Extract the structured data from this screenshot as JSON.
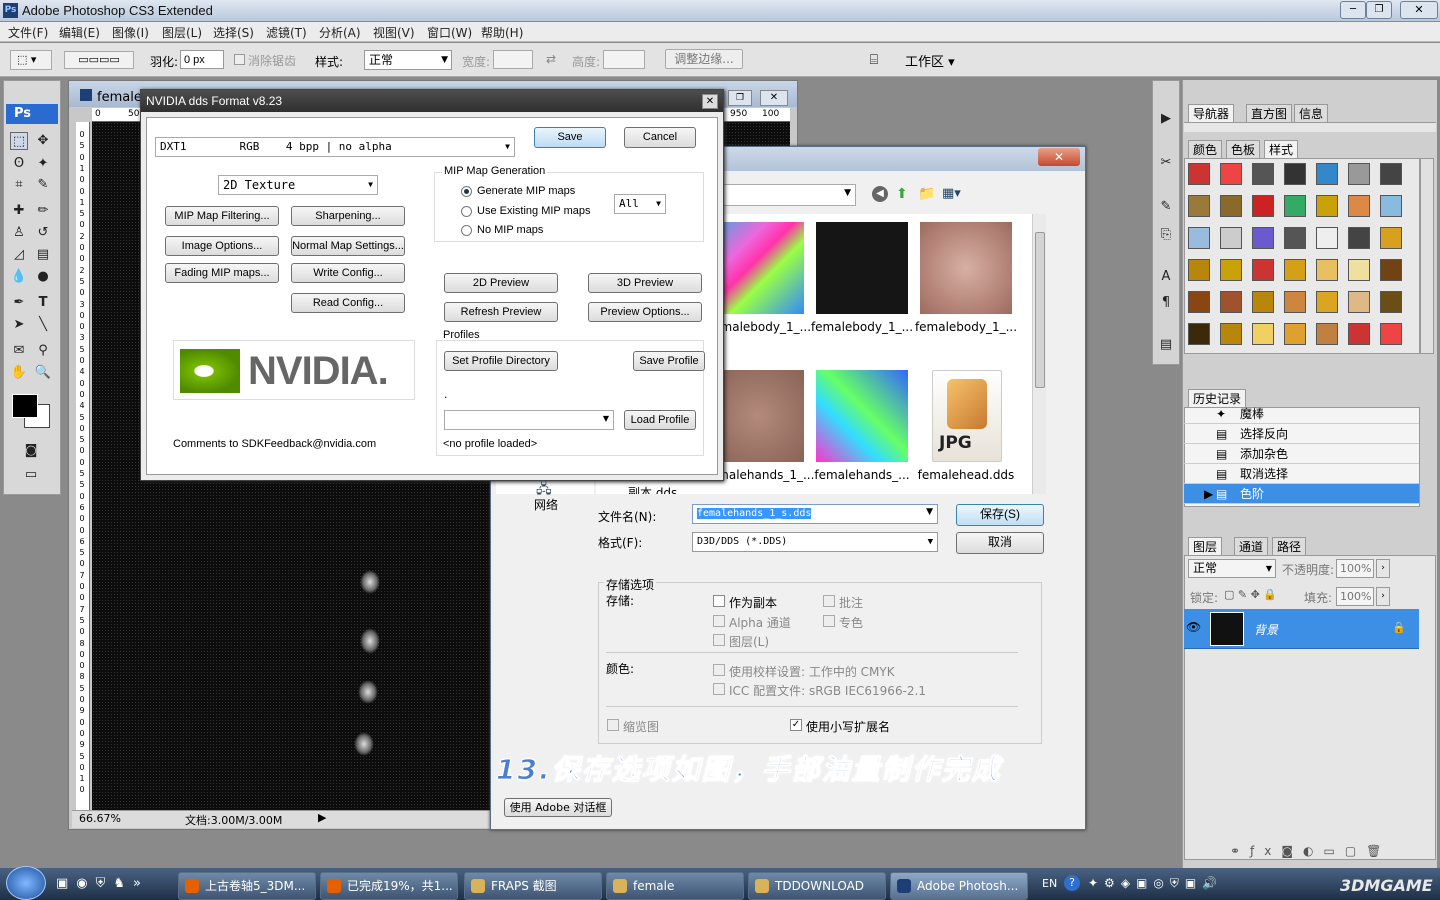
{
  "app": {
    "title": "Adobe Photoshop CS3 Extended",
    "logo": "Ps"
  },
  "menu": [
    "文件(F)",
    "编辑(E)",
    "图像(I)",
    "图层(L)",
    "选择(S)",
    "滤镜(T)",
    "分析(A)",
    "视图(V)",
    "窗口(W)",
    "帮助(H)"
  ],
  "options_bar": {
    "feather_label": "羽化:",
    "feather_value": "0 px",
    "antialias_label": "消除锯齿",
    "style_label": "样式:",
    "style_value": "正常",
    "width_label": "宽度:",
    "height_label": "高度:",
    "refine_edge": "调整边缘...",
    "workspace": "工作区 ▾"
  },
  "document": {
    "tab_title": "female",
    "zoom": "66.67%",
    "doc_info": "文档:3.00M/3.00M",
    "ruler_top": [
      "0",
      "50",
      "950",
      "100"
    ],
    "ruler_left": [
      "0",
      "5",
      "0",
      "1",
      "0",
      "0",
      "1",
      "5",
      "0",
      "2",
      "0",
      "0",
      "2",
      "5",
      "0",
      "3",
      "0",
      "0",
      "3",
      "5",
      "0",
      "4",
      "0",
      "0",
      "4",
      "5",
      "0",
      "5",
      "0",
      "0",
      "5",
      "5",
      "0",
      "6",
      "0",
      "0",
      "6",
      "5",
      "0",
      "7",
      "0",
      "0",
      "7",
      "5",
      "0",
      "8",
      "0",
      "0",
      "8",
      "5",
      "0",
      "9",
      "0",
      "0",
      "9",
      "5",
      "0",
      "1",
      "0"
    ]
  },
  "nvidia": {
    "title": "NVIDIA dds Format v8.23",
    "format_value": "DXT1        RGB    4 bpp | no alpha",
    "texture_type": "2D Texture",
    "save": "Save",
    "cancel": "Cancel",
    "mip_group": "MIP Map Generation",
    "mip_opt1": "Generate MIP maps",
    "mip_opt2": "Use Existing MIP maps",
    "mip_opt3": "No MIP maps",
    "mip_count": "All",
    "btn_mip_filter": "MIP Map Filtering...",
    "btn_sharpen": "Sharpening...",
    "btn_image_opts": "Image Options...",
    "btn_normal": "Normal Map Settings...",
    "btn_fading": "Fading MIP maps...",
    "btn_write": "Write Config...",
    "btn_read": "Read Config...",
    "btn_2d": "2D Preview",
    "btn_3d": "3D Preview",
    "btn_refresh": "Refresh Preview",
    "btn_preview_opts": "Preview Options...",
    "profiles_label": "Profiles",
    "btn_set_profile": "Set Profile Directory",
    "btn_save_profile": "Save Profile",
    "profile_dot": ".",
    "btn_load_profile": "Load Profile",
    "no_profile": "<no profile loaded>",
    "logo": "NVIDIA.",
    "comments": "Comments to SDKFeedback@nvidia.com"
  },
  "save_dialog": {
    "files": [
      "femalebody_1_...",
      "femalebody_1_...",
      "femalebody_1_...",
      "femalehands_1_...",
      "femalehands_...",
      "femalehead.dds"
    ],
    "partial_file": "副本 dds",
    "jpg_label": "JPG",
    "network": "网络",
    "filename_label": "文件名(N):",
    "filename_value": "femalehands_1_s.dds",
    "format_label": "格式(F):",
    "format_value": "D3D/DDS (*.DDS)",
    "save_btn": "保存(S)",
    "cancel_btn": "取消",
    "storage_options": "存储选项",
    "storage_label": "存储:",
    "as_copy": "作为副本",
    "alpha": "Alpha 通道",
    "layers": "图层(L)",
    "notes": "批注",
    "spot": "专色",
    "color_label": "颜色:",
    "proof": "使用校样设置: 工作中的 CMYK",
    "icc": "ICC 配置文件: sRGB IEC61966-2.1",
    "thumbnail": "缩览图",
    "lowercase_ext": "使用小写扩展名",
    "adobe_dialog": "使用 Adobe 对话框"
  },
  "caption": "13.保存选项如图，手部油量制作完成",
  "panels": {
    "nav_tabs": [
      "导航器",
      "直方图",
      "信息"
    ],
    "style_tabs": [
      "颜色",
      "色板",
      "样式"
    ],
    "history_tab": "历史记录",
    "history": [
      "魔棒",
      "选择反向",
      "添加杂色",
      "取消选择",
      "色阶"
    ],
    "layer_tabs": [
      "图层",
      "通道",
      "路径"
    ],
    "blend_mode": "正常",
    "opacity_label": "不透明度:",
    "opacity_value": "100%",
    "lock_label": "锁定:",
    "fill_label": "填充:",
    "fill_value": "100%",
    "layer_name": "背景"
  },
  "taskbar": {
    "items": [
      "上古卷轴5_3DM...",
      "已完成19%，共1...",
      "FRAPS 截图",
      "female",
      "TDDOWNLOAD",
      "Adobe Photosh..."
    ],
    "lang": "EN",
    "watermark": "3DMGAME"
  },
  "colors": {
    "title_bar": "#c7d3e3",
    "selection": "#3399ff",
    "layer_highlight": "#3d8fe6",
    "taskbar": "#2b3f58",
    "caption": "#4a7fd0"
  }
}
